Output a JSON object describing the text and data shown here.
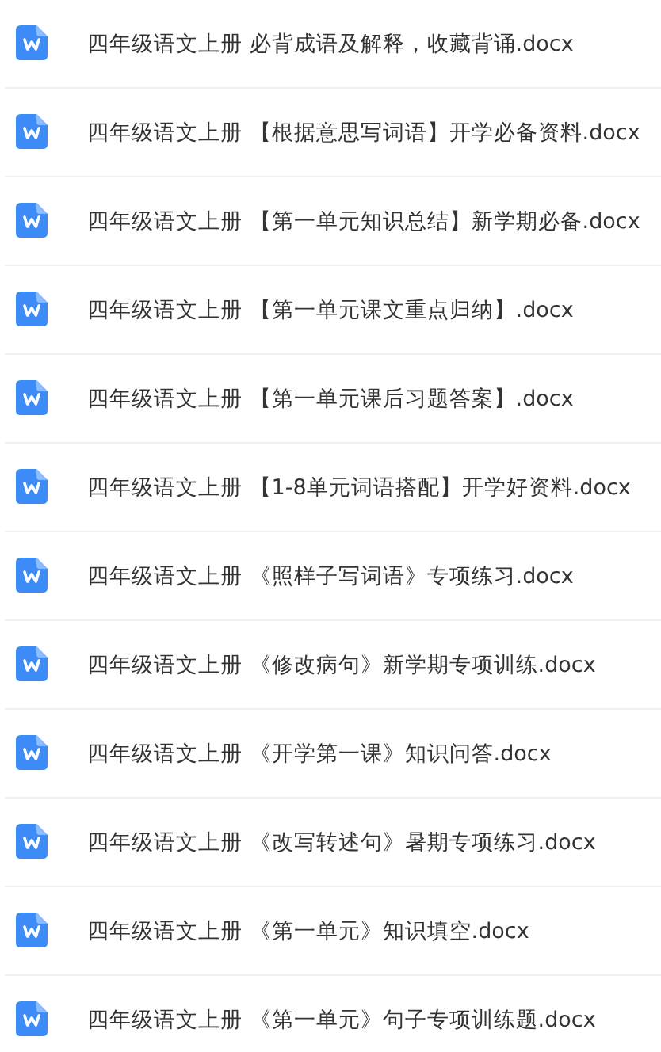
{
  "files": [
    {
      "name": "四年级语文上册 必背成语及解释，收藏背诵.docx"
    },
    {
      "name": "四年级语文上册 【根据意思写词语】开学必备资料.docx"
    },
    {
      "name": "四年级语文上册 【第一单元知识总结】新学期必备.docx"
    },
    {
      "name": "四年级语文上册 【第一单元课文重点归纳】.docx"
    },
    {
      "name": "四年级语文上册 【第一单元课后习题答案】.docx"
    },
    {
      "name": "四年级语文上册 【1-8单元词语搭配】开学好资料.docx"
    },
    {
      "name": "四年级语文上册 《照样子写词语》专项练习.docx"
    },
    {
      "name": "四年级语文上册 《修改病句》新学期专项训练.docx"
    },
    {
      "name": "四年级语文上册 《开学第一课》知识问答.docx"
    },
    {
      "name": "四年级语文上册 《改写转述句》暑期专项练习.docx"
    },
    {
      "name": "四年级语文上册 《第一单元》知识填空.docx"
    },
    {
      "name": "四年级语文上册 《第一单元》句子专项训练题.docx"
    }
  ]
}
